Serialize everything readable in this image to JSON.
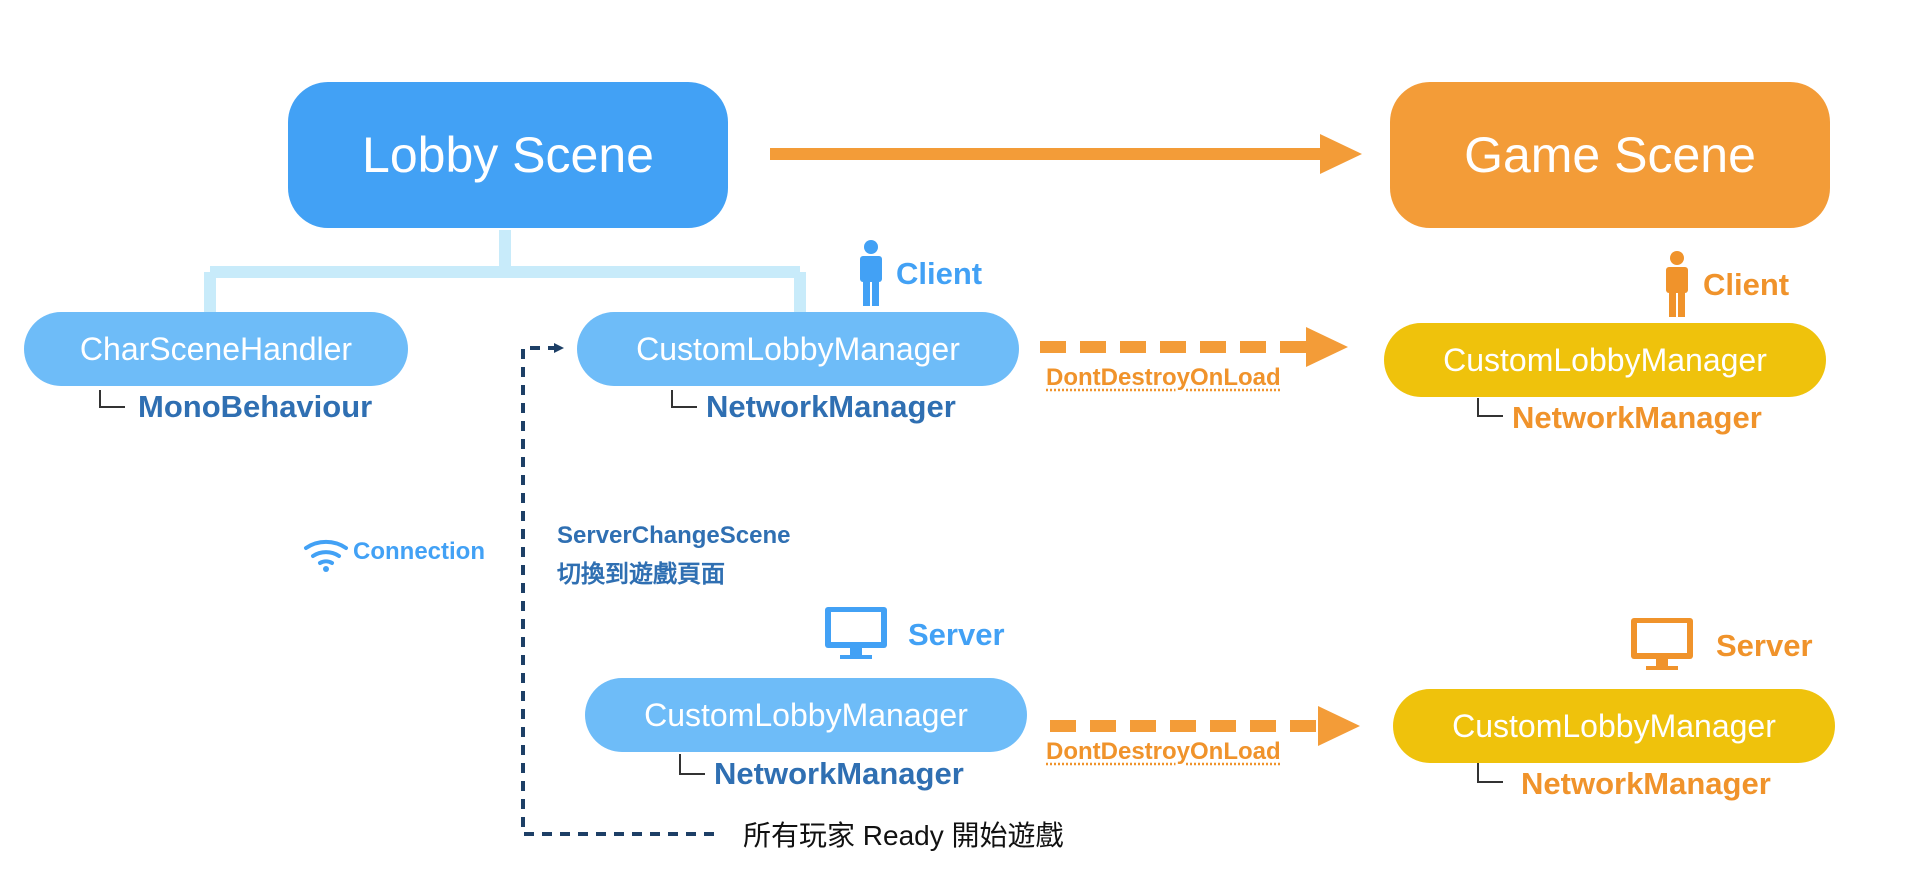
{
  "scenes": {
    "lobby": "Lobby Scene",
    "game": "Game Scene"
  },
  "lobby": {
    "char_scene_handler": "CharSceneHandler",
    "mono_behaviour": "MonoBehaviour",
    "client_label": "Client",
    "client_manager": "CustomLobbyManager",
    "client_network_manager": "NetworkManager",
    "server_label": "Server",
    "server_manager": "CustomLobbyManager",
    "server_network_manager": "NetworkManager"
  },
  "game": {
    "client_label": "Client",
    "client_manager": "CustomLobbyManager",
    "client_network_manager": "NetworkManager",
    "server_label": "Server",
    "server_manager": "CustomLobbyManager",
    "server_network_manager": "NetworkManager"
  },
  "connection_label": "Connection",
  "server_change_scene": "ServerChangeScene",
  "switch_to_game_page": "切換到遊戲頁面",
  "dont_destroy_on_load_client": "DontDestroyOnLoad",
  "dont_destroy_on_load_server": "DontDestroyOnLoad",
  "all_players_ready": "所有玩家 Ready 開始遊戲",
  "colors": {
    "lobby_blue": "#42a1f5",
    "game_orange": "#f39c38",
    "light_blue_pill": "#6ebcf8",
    "yellow_pill": "#efc20c",
    "dark_blue_text": "#2f6fb2",
    "navy_dashed": "#1d3f66",
    "connector_cyan": "#c8ebfa"
  },
  "icons": [
    "person-icon",
    "monitor-icon",
    "wifi-icon"
  ]
}
